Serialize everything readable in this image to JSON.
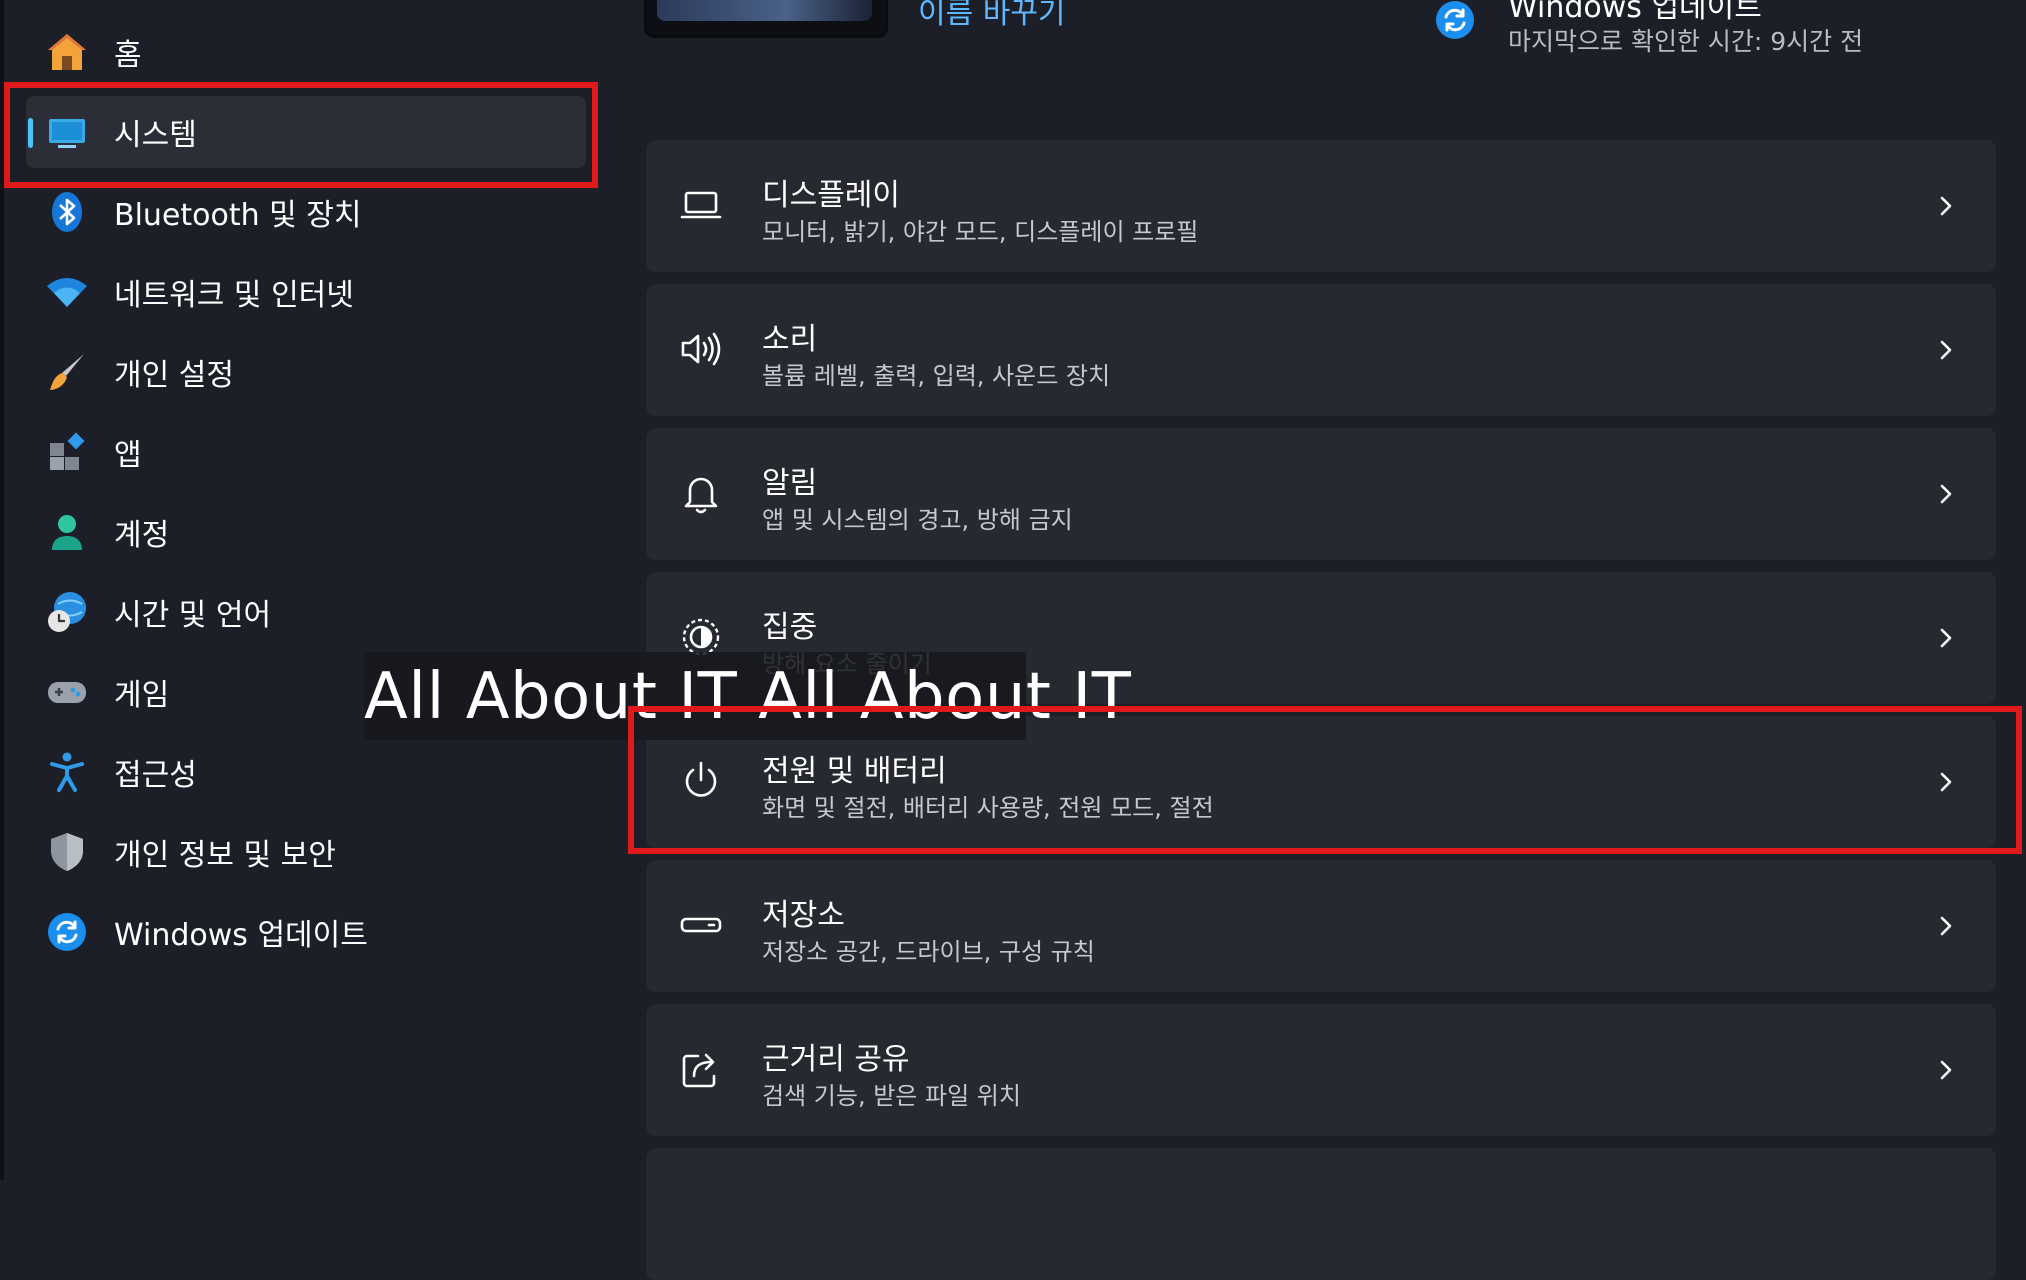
{
  "top": {
    "rename_link": "이름 바꾸기",
    "update_title": "Windows 업데이트",
    "update_subtitle": "마지막으로 확인한 시간: 9시간 전"
  },
  "sidebar": {
    "items": [
      {
        "label": "홈",
        "icon": "home-icon"
      },
      {
        "label": "시스템",
        "icon": "system-icon",
        "selected": true
      },
      {
        "label": "Bluetooth 및 장치",
        "icon": "bluetooth-icon"
      },
      {
        "label": "네트워크 및 인터넷",
        "icon": "wifi-icon"
      },
      {
        "label": "개인 설정",
        "icon": "brush-icon"
      },
      {
        "label": "앱",
        "icon": "apps-icon"
      },
      {
        "label": "계정",
        "icon": "account-icon"
      },
      {
        "label": "시간 및 언어",
        "icon": "time-language-icon"
      },
      {
        "label": "게임",
        "icon": "gamepad-icon"
      },
      {
        "label": "접근성",
        "icon": "accessibility-icon"
      },
      {
        "label": "개인 정보 및 보안",
        "icon": "shield-icon"
      },
      {
        "label": "Windows 업데이트",
        "icon": "update-icon"
      }
    ]
  },
  "main": {
    "cards": [
      {
        "title": "디스플레이",
        "subtitle": "모니터, 밝기, 야간 모드, 디스플레이 프로필",
        "icon": "display-icon"
      },
      {
        "title": "소리",
        "subtitle": "볼륨 레벨, 출력, 입력, 사운드 장치",
        "icon": "speaker-icon"
      },
      {
        "title": "알림",
        "subtitle": "앱 및 시스템의 경고, 방해 금지",
        "icon": "bell-icon"
      },
      {
        "title": "집중",
        "subtitle": "방해 요소 줄이기",
        "icon": "focus-icon"
      },
      {
        "title": "전원 및 배터리",
        "subtitle": "화면 및 절전, 배터리 사용량, 전원 모드, 절전",
        "icon": "power-icon"
      },
      {
        "title": "저장소",
        "subtitle": "저장소 공간, 드라이브, 구성 규칙",
        "icon": "storage-icon"
      },
      {
        "title": "근거리 공유",
        "subtitle": "검색 기능, 받은 파일 위치",
        "icon": "share-icon"
      }
    ]
  },
  "watermark": "All About IT All About IT",
  "colors": {
    "background": "#1c1f27",
    "card": "#262930",
    "selected_nav": "#2b2e36",
    "accent": "#4cc2ff",
    "link": "#5fb7ff",
    "highlight": "#e0191b"
  }
}
